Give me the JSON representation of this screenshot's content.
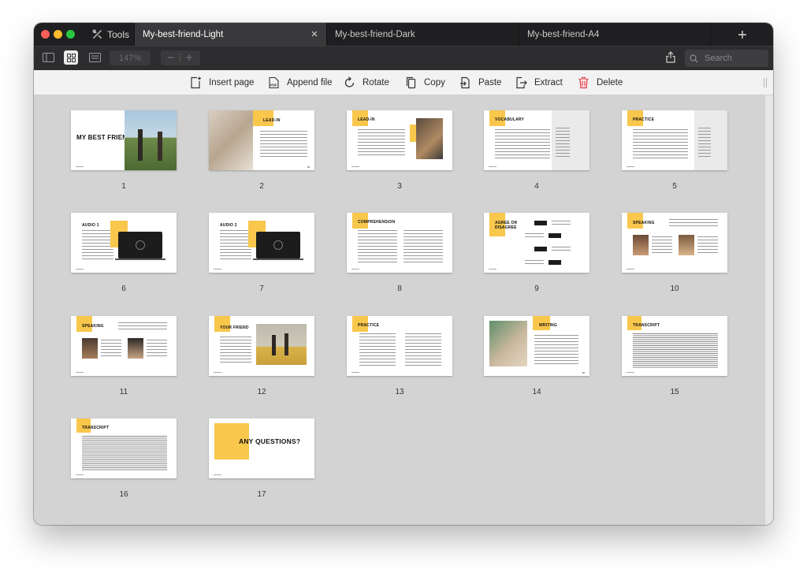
{
  "toolbar": {
    "tools_label": "Tools",
    "zoom_value": "147%",
    "search_placeholder": "Search"
  },
  "tabs": [
    {
      "label": "My-best-friend-Light",
      "active": true
    },
    {
      "label": "My-best-friend-Dark",
      "active": false
    },
    {
      "label": "My-best-friend-A4",
      "active": false
    }
  ],
  "actions": {
    "insert": "Insert page",
    "append": "Append file",
    "rotate": "Rotate",
    "copy": "Copy",
    "paste": "Paste",
    "extract": "Extract",
    "delete": "Delete"
  },
  "colors": {
    "accent": "#f8c74c",
    "delete": "#e0414a",
    "chrome_dark": "#1f1f21",
    "toolbar_dark": "#2d2d2f"
  },
  "slides": [
    {
      "number": "1",
      "title": "MY BEST FRIEND"
    },
    {
      "number": "2",
      "title": "LEAD-IN"
    },
    {
      "number": "3",
      "title": "LEAD-IN"
    },
    {
      "number": "4",
      "title": "VOCABULARY"
    },
    {
      "number": "5",
      "title": "PRACTICE"
    },
    {
      "number": "6",
      "title": "AUDIO 1"
    },
    {
      "number": "7",
      "title": "AUDIO 2"
    },
    {
      "number": "8",
      "title": "COMPREHENSION"
    },
    {
      "number": "9",
      "title": "AGREE OR DISAGREE"
    },
    {
      "number": "10",
      "title": "SPEAKING"
    },
    {
      "number": "11",
      "title": "SPEAKING"
    },
    {
      "number": "12",
      "title": "YOUR FRIEND"
    },
    {
      "number": "13",
      "title": "PRACTICE"
    },
    {
      "number": "14",
      "title": "WRITING"
    },
    {
      "number": "15",
      "title": "TRANSCRIPT"
    },
    {
      "number": "16",
      "title": "TRANSCRIPT"
    },
    {
      "number": "17",
      "title": "ANY QUESTIONS?"
    }
  ]
}
